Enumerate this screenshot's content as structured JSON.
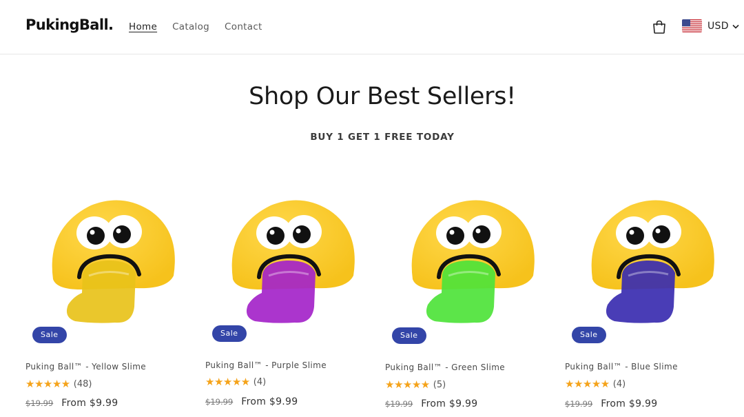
{
  "header": {
    "logo": "PukingBall.",
    "nav": [
      "Home",
      "Catalog",
      "Contact"
    ],
    "currency": "USD"
  },
  "hero": {
    "title": "Shop Our Best Sellers!",
    "subtitle": "BUY 1 GET 1 FREE TODAY"
  },
  "products": [
    {
      "badge": "Sale",
      "title": "Puking Ball™ - Yellow Slime",
      "stars": "★★★★★",
      "reviews": "(48)",
      "compare_price": "$19.99",
      "price": "From $9.99",
      "slime_color": "#e8c21a"
    },
    {
      "badge": "Sale",
      "title": "Puking Ball™ - Purple Slime",
      "stars": "★★★★★",
      "reviews": "(4)",
      "compare_price": "$19.99",
      "price": "From $9.99",
      "slime_color": "#a424c9"
    },
    {
      "badge": "Sale",
      "title": "Puking Ball™ - Green Slime",
      "stars": "★★★★★",
      "reviews": "(5)",
      "compare_price": "$19.99",
      "price": "From $9.99",
      "slime_color": "#4ee33a"
    },
    {
      "badge": "Sale",
      "title": "Puking Ball™ - Blue Slime",
      "stars": "★★★★★",
      "reviews": "(4)",
      "compare_price": "$19.99",
      "price": "From $9.99",
      "slime_color": "#3a2db0"
    }
  ],
  "colors": {
    "sale_badge": "#3345a8",
    "star": "#f5a31a",
    "ball": "#f6c21c"
  }
}
